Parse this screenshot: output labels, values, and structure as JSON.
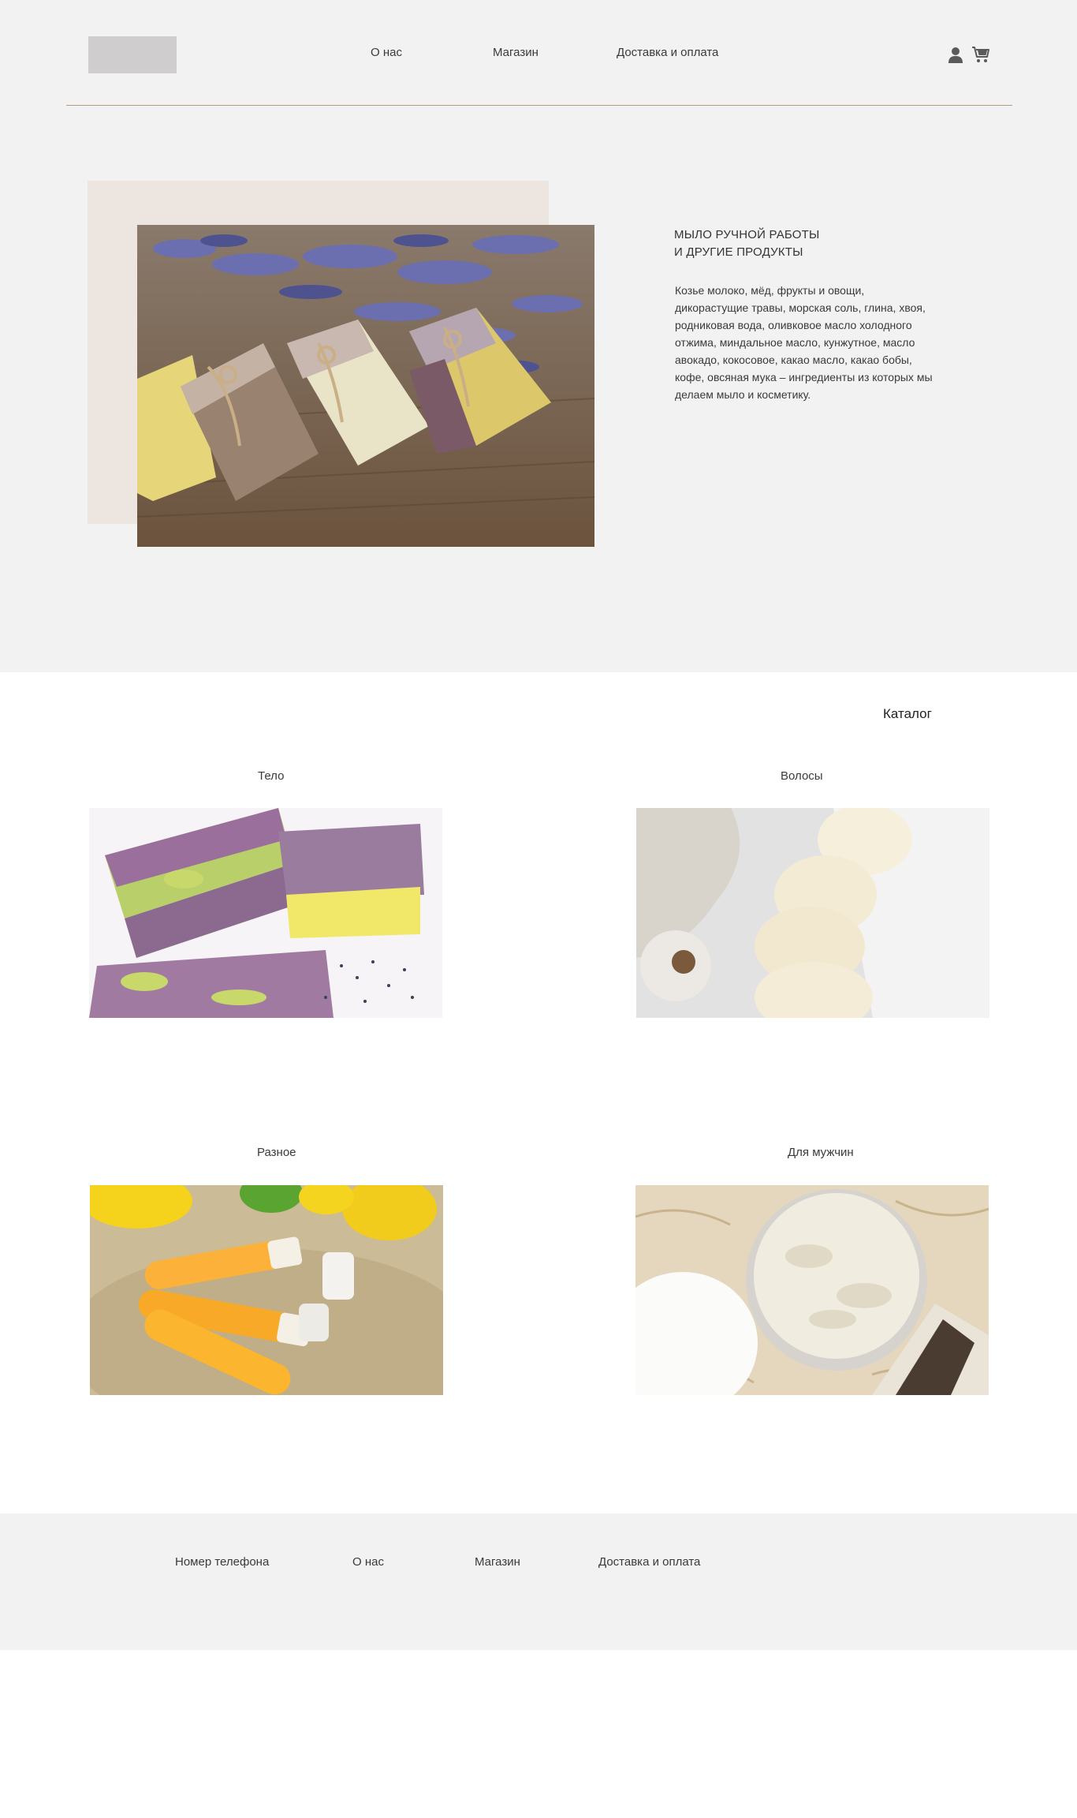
{
  "header": {
    "nav": [
      "О нас",
      "Магазин",
      "Доставка  и оплата"
    ],
    "icons": [
      "user-icon",
      "cart-icon"
    ]
  },
  "hero": {
    "title_line1": "МЫЛО РУЧНОЙ РАБОТЫ",
    "title_line2": "И ДРУГИЕ ПРОДУКТЫ",
    "text": "Козье молоко, мёд, фрукты и овощи, дикорастущие травы, морская соль, глина, хвоя, родниковая вода, оливковое масло холодного отжима, миндальное масло, кунжутное, масло авокадо, кокосовое, какао масло, какао бобы, кофе, овсяная мука – ингредиенты из которых мы делаем мыло и косметику."
  },
  "catalog": {
    "title": "Каталог",
    "items": [
      {
        "label": "Тело"
      },
      {
        "label": "Волосы"
      },
      {
        "label": "Разное"
      },
      {
        "label": "Для мужчин"
      }
    ]
  },
  "footer": {
    "phone": "Номер телефона",
    "nav": [
      "О нас",
      "Магазин",
      "Доставка  и оплата"
    ]
  },
  "colors": {
    "background": "#f2f2f2",
    "accent_line": "#b59a80",
    "hero_backdrop": "#ede5e0",
    "logo_placeholder": "#cfcdcd"
  }
}
